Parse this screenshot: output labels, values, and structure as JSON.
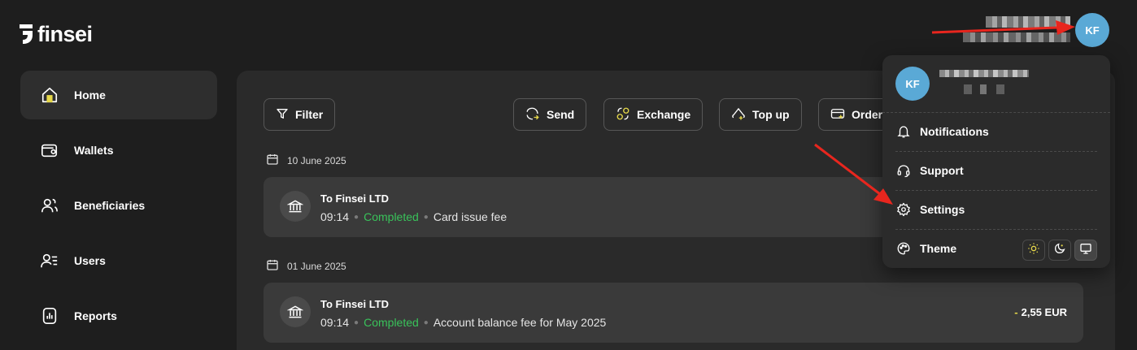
{
  "brand": {
    "logo_text": "finsei"
  },
  "user": {
    "initials": "KF"
  },
  "sidebar": {
    "items": [
      {
        "label": "Home",
        "icon": "home-icon",
        "active": true
      },
      {
        "label": "Wallets",
        "icon": "wallet-icon"
      },
      {
        "label": "Beneficiaries",
        "icon": "users-icon"
      },
      {
        "label": "Users",
        "icon": "user-list-icon"
      },
      {
        "label": "Reports",
        "icon": "report-icon"
      }
    ]
  },
  "toolbar": {
    "filter": "Filter",
    "send": "Send",
    "exchange": "Exchange",
    "topup": "Top up",
    "order": "Order"
  },
  "transactions": [
    {
      "date": "10 June 2025",
      "title": "To Finsei LTD",
      "time": "09:14",
      "status": "Completed",
      "description": "Card issue fee"
    },
    {
      "date": "01 June 2025",
      "title": "To Finsei LTD",
      "time": "09:14",
      "status": "Completed",
      "description": "Account balance fee for May 2025",
      "amount_sign": "-",
      "amount": "2,55 EUR"
    }
  ],
  "menu": {
    "notifications": "Notifications",
    "support": "Support",
    "settings": "Settings",
    "theme": "Theme",
    "theme_options": [
      "light",
      "dark",
      "system"
    ],
    "theme_selected": "system"
  },
  "colors": {
    "accent": "#e6d84a",
    "status_completed": "#39c25a",
    "avatar": "#5aa9d6",
    "annotation_arrow": "#e8261e"
  }
}
